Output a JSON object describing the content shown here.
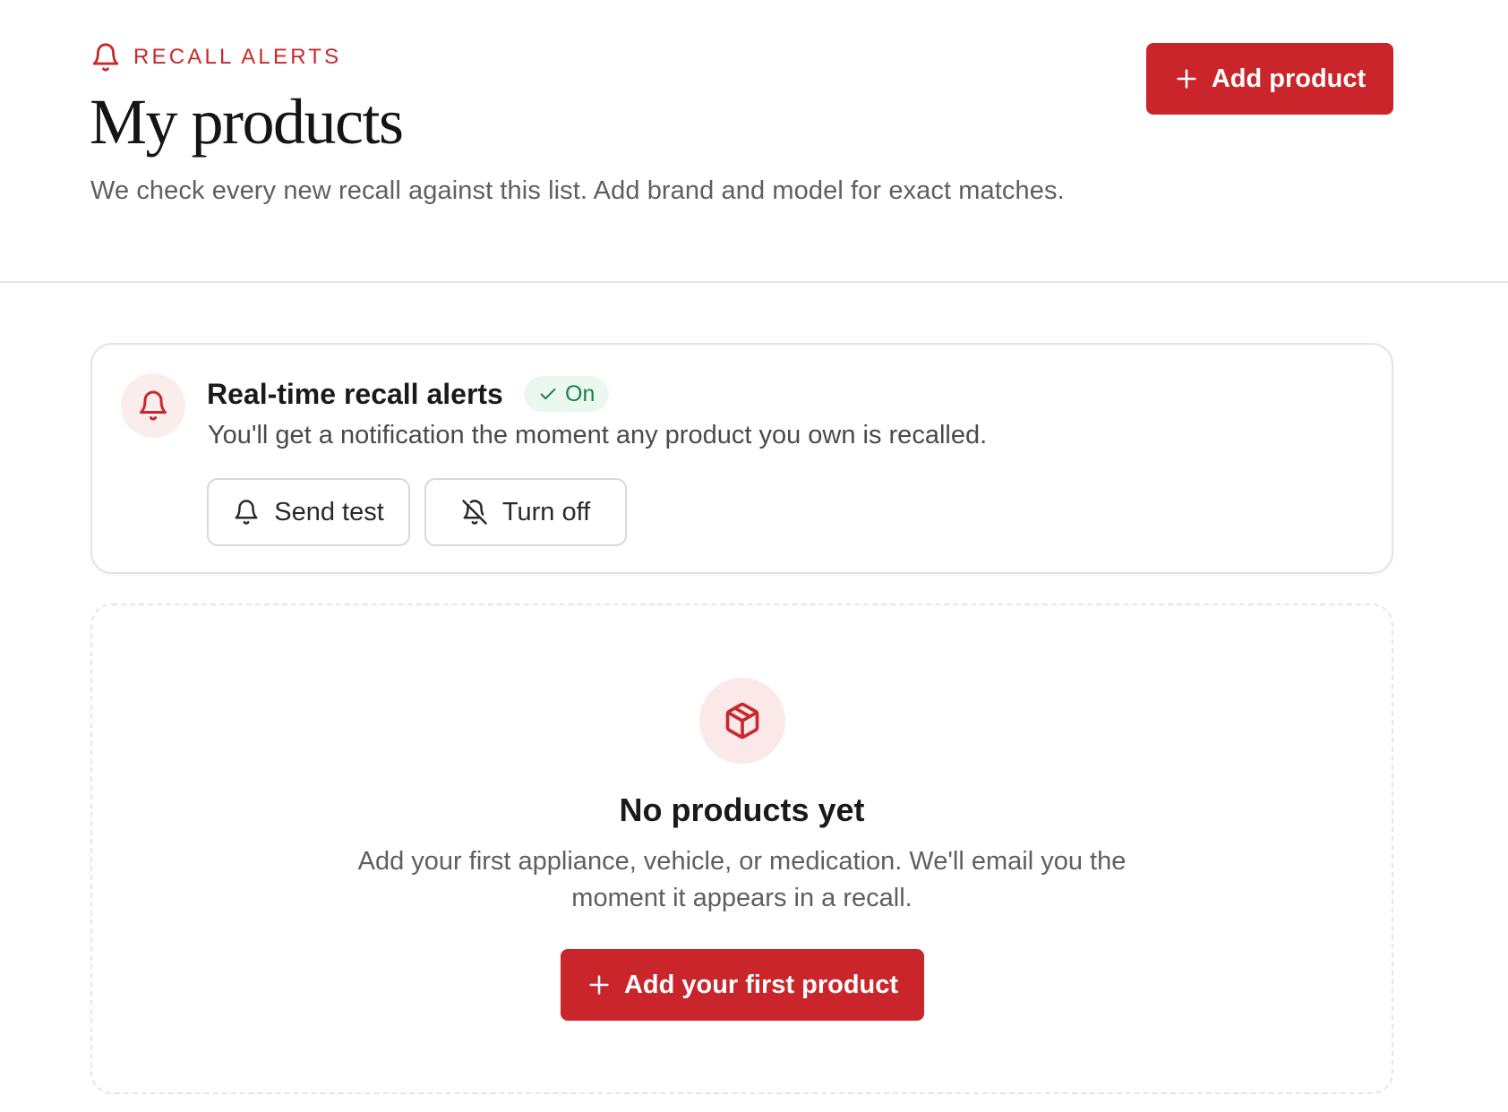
{
  "header": {
    "eyebrow": "RECALL ALERTS",
    "title": "My products",
    "subtitle": "We check every new recall against this list. Add brand and model for exact matches.",
    "add_button_label": "Add product"
  },
  "alert_card": {
    "title": "Real-time recall alerts",
    "status": "On",
    "description": "You'll get a notification the moment any product you own is recalled.",
    "send_test_label": "Send test",
    "turn_off_label": "Turn off"
  },
  "empty_state": {
    "title": "No products yet",
    "description_line1": "Add your first appliance, vehicle, or medication. We'll email you the",
    "description_line2": "moment it appears in a recall.",
    "button_label": "Add your first product"
  },
  "icons": {
    "eyebrow": "bell-icon",
    "add": "plus-icon",
    "alert": "bell-icon",
    "status": "check-icon",
    "send_test": "bell-icon",
    "turn_off": "bell-off-icon",
    "empty": "package-icon"
  },
  "colors": {
    "brand_red": "#c9252a",
    "success_green": "#17804a",
    "success_bg": "#eaf8f0",
    "icon_bg": "#fceded"
  }
}
